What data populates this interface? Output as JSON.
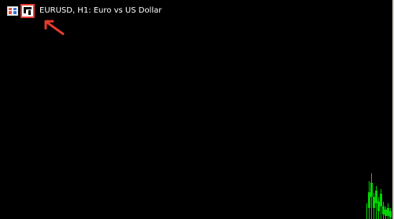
{
  "chart": {
    "symbol": "EURUSD",
    "timeframe": "H1",
    "title_text": "EURUSD, H1:  Euro vs US Dollar",
    "colors": {
      "background": "#000000",
      "candles": "#00d400",
      "annotation": "#e33b2e"
    }
  },
  "icons": {
    "one_click_trading": "one-click-trading-icon",
    "market_depth": "market-depth-icon",
    "annotation_arrow": "arrow-icon"
  }
}
